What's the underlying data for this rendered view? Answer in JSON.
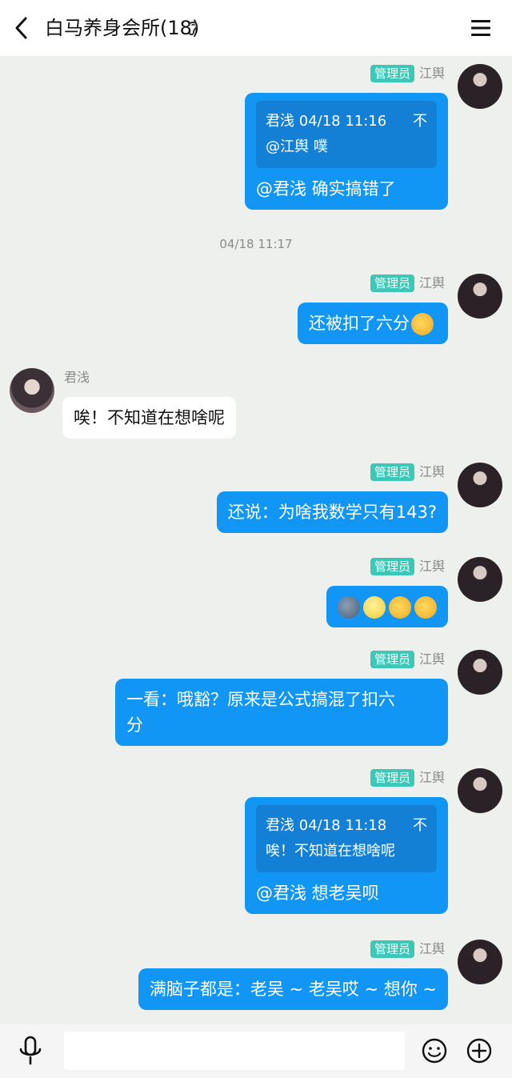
{
  "header": {
    "title": "白马养身会所(18)"
  },
  "messages": {
    "m1": {
      "badge": "管理员",
      "sender": "江舆",
      "quote_line1": "君浅 04/18 11:16",
      "quote_right": "不",
      "quote_line2": "@江舆 噗",
      "text": "@君浅 确实搞错了"
    },
    "timestamp1": "04/18 11:17",
    "m2": {
      "badge": "管理员",
      "sender": "江舆",
      "text": "还被扣了六分"
    },
    "m3": {
      "sender": "君浅",
      "text": "唉！不知道在想啥呢"
    },
    "m4": {
      "badge": "管理员",
      "sender": "江舆",
      "text": "还说：为啥我数学只有143?"
    },
    "m5": {
      "badge": "管理员",
      "sender": "江舆"
    },
    "m6": {
      "badge": "管理员",
      "sender": "江舆",
      "text_line1": "一看：哦豁？原来是公式搞混了扣六",
      "text_line2": "分"
    },
    "m7": {
      "badge": "管理员",
      "sender": "江舆",
      "quote_line1": "君浅 04/18 11:18",
      "quote_right": "不",
      "quote_line2": "唉！不知道在想啥呢",
      "text": "@君浅 想老吴呗"
    },
    "m8": {
      "badge": "管理员",
      "sender": "江舆",
      "text": "满脑子都是：老吴 ~ 老吴哎 ~ 想你 ~"
    }
  },
  "input": {
    "value": "",
    "placeholder": ""
  },
  "icons": {
    "back": "back-arrow-icon",
    "ear": "ear-icon",
    "menu": "menu-icon",
    "mic": "microphone-icon",
    "emoji": "emoji-icon",
    "plus": "plus-icon"
  },
  "colors": {
    "accent_bubble": "#1296f5",
    "admin_badge": "#3cc7b6",
    "background": "#eef0ed"
  }
}
